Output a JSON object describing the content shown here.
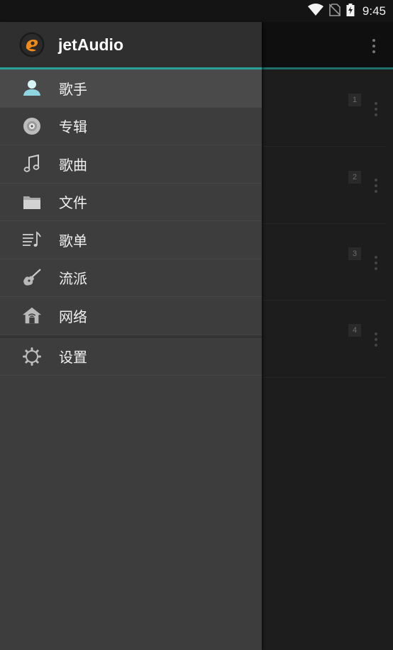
{
  "status": {
    "time": "9:45"
  },
  "app": {
    "title": "jetAudio"
  },
  "menu": {
    "items": [
      {
        "label": "歌手",
        "icon": "artist-icon",
        "selected": true
      },
      {
        "label": "专辑",
        "icon": "album-disc-icon"
      },
      {
        "label": "歌曲",
        "icon": "music-note-icon"
      },
      {
        "label": "文件",
        "icon": "folder-icon"
      },
      {
        "label": "歌单",
        "icon": "playlist-icon"
      },
      {
        "label": "流派",
        "icon": "guitar-icon"
      },
      {
        "label": "网络",
        "icon": "network-home-icon"
      }
    ],
    "settings": {
      "label": "设置",
      "icon": "gear-icon"
    }
  },
  "background_list": {
    "numbers": [
      "1",
      "2",
      "3",
      "4"
    ]
  },
  "colors": {
    "accent": "#2aa198",
    "drawer": "#3d3d3d",
    "logo_orange": "#f28a1a"
  }
}
